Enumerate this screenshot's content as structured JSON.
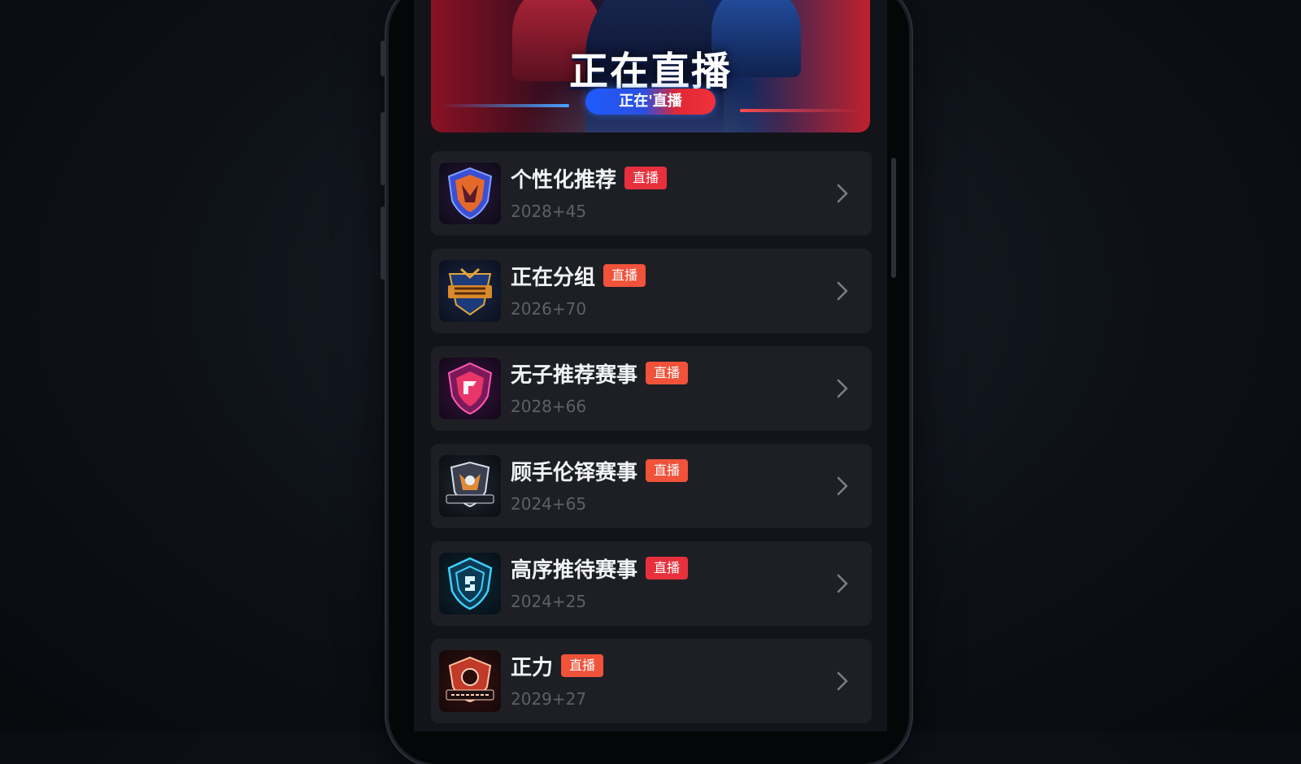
{
  "banner": {
    "title": "正在直播",
    "pill_label": "正在'直播"
  },
  "colors": {
    "row_background": "#1e1f25",
    "badge_red": "#e8303d",
    "badge_orange": "#f0523a",
    "subtitle_gray": "#5d6068"
  },
  "list": {
    "items": [
      {
        "title": "个性化推荐",
        "badge": "直播",
        "subtitle": "2028+45",
        "logo_icon": "shield-fox-icon",
        "badge_color": "#e8303d"
      },
      {
        "title": "正在分组",
        "badge": "直播",
        "subtitle": "2026+70",
        "logo_icon": "gold-crest-icon",
        "badge_color": "#f0523a"
      },
      {
        "title": "无子推荐赛事",
        "badge": "直播",
        "subtitle": "2028+66",
        "logo_icon": "pink-shield-icon",
        "badge_color": "#f0523a"
      },
      {
        "title": "顾手伦铎赛事",
        "badge": "直播",
        "subtitle": "2024+65",
        "logo_icon": "silver-crest-icon",
        "badge_color": "#f0523a"
      },
      {
        "title": "高序推待赛事",
        "badge": "直播",
        "subtitle": "2024+25",
        "logo_icon": "cyan-shield-icon",
        "badge_color": "#e8303d"
      },
      {
        "title": "正力",
        "badge": "直播",
        "subtitle": "2029+27",
        "logo_icon": "red-shield-icon",
        "badge_color": "#f0523a"
      }
    ]
  }
}
